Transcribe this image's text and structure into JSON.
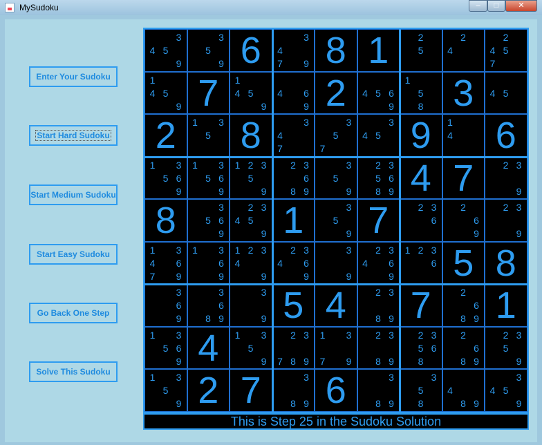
{
  "window": {
    "title": "MySudoku",
    "minimize": "–",
    "maximize": "□",
    "close": "✕"
  },
  "buttons": [
    {
      "label": "Enter Your Sudoku"
    },
    {
      "label": "Start Hard Sudoku"
    },
    {
      "label": "Start Medium Sudoku"
    },
    {
      "label": "Start Easy Sudoku"
    },
    {
      "label": "Go Back One Step"
    },
    {
      "label": "Solve This Sudoku"
    }
  ],
  "status": "This is Step  25  in the Sudoku Solution",
  "grid": [
    [
      [
        3,
        4,
        5,
        9
      ],
      [
        3,
        5,
        9
      ],
      6,
      [
        4,
        7,
        3,
        9
      ],
      8,
      1,
      [
        2,
        5
      ],
      [
        2,
        4
      ],
      [
        2,
        4,
        5,
        7
      ]
    ],
    [
      [
        1,
        4,
        5,
        9
      ],
      7,
      [
        1,
        4,
        5,
        9
      ],
      [
        4,
        6,
        9
      ],
      2,
      [
        4,
        5,
        6,
        9
      ],
      [
        1,
        5,
        8
      ],
      3,
      [
        4,
        5
      ]
    ],
    [
      2,
      [
        1,
        3,
        5
      ],
      8,
      [
        3,
        4,
        7
      ],
      [
        3,
        5,
        7
      ],
      [
        3,
        4,
        5
      ],
      9,
      [
        1,
        4
      ],
      6
    ],
    [
      [
        1,
        3,
        5,
        6,
        9
      ],
      [
        1,
        3,
        5,
        6,
        9
      ],
      [
        1,
        2,
        3,
        5,
        9
      ],
      [
        2,
        3,
        6,
        8,
        9
      ],
      [
        3,
        5,
        9
      ],
      [
        2,
        3,
        5,
        6,
        8,
        9
      ],
      4,
      7,
      [
        2,
        3,
        9
      ]
    ],
    [
      8,
      [
        3,
        5,
        6,
        9
      ],
      [
        2,
        3,
        4,
        5,
        9
      ],
      1,
      [
        3,
        5,
        9
      ],
      7,
      [
        2,
        3,
        6
      ],
      [
        2,
        6,
        9
      ],
      [
        2,
        3,
        9
      ]
    ],
    [
      [
        1,
        3,
        4,
        6,
        7,
        9
      ],
      [
        1,
        3,
        6,
        9
      ],
      [
        1,
        2,
        3,
        4,
        9
      ],
      [
        2,
        3,
        4,
        6,
        9
      ],
      [
        3,
        9
      ],
      [
        2,
        3,
        4,
        6,
        9
      ],
      [
        1,
        2,
        3,
        6
      ],
      5,
      8
    ],
    [
      [
        3,
        6,
        9
      ],
      [
        3,
        6,
        8,
        9
      ],
      [
        3,
        9
      ],
      5,
      4,
      [
        2,
        3,
        8,
        9
      ],
      7,
      [
        2,
        6,
        8,
        9
      ],
      1
    ],
    [
      [
        1,
        3,
        5,
        6,
        9
      ],
      4,
      [
        1,
        3,
        5,
        9
      ],
      [
        2,
        3,
        7,
        8,
        9
      ],
      [
        1,
        3,
        7,
        9
      ],
      [
        2,
        3,
        8,
        9
      ],
      [
        2,
        3,
        5,
        6,
        8
      ],
      [
        2,
        6,
        8,
        9
      ],
      [
        2,
        3,
        5,
        9
      ]
    ],
    [
      [
        1,
        3,
        5,
        9
      ],
      2,
      7,
      [
        3,
        8,
        9
      ],
      6,
      [
        3,
        8,
        9
      ],
      [
        3,
        5,
        8
      ],
      [
        4,
        8,
        9
      ],
      [
        3,
        4,
        5,
        9
      ]
    ]
  ]
}
